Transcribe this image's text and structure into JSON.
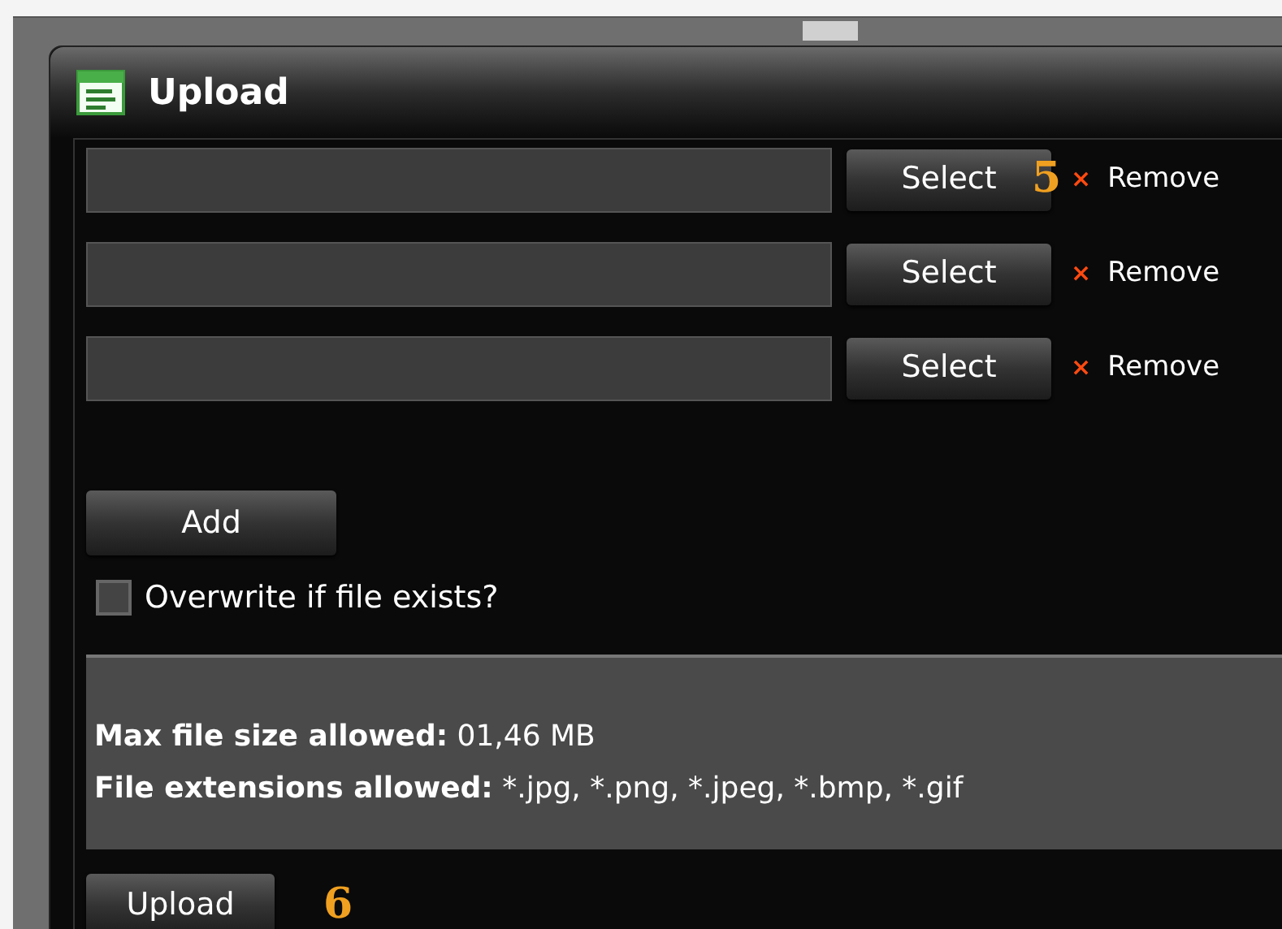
{
  "window": {
    "title": "Upload"
  },
  "file_rows": [
    {
      "select_label": "Select",
      "remove_label": "×",
      "remove_text": "Remove",
      "callout": "5"
    },
    {
      "select_label": "Select",
      "remove_label": "×",
      "remove_text": "Remove"
    },
    {
      "select_label": "Select",
      "remove_label": "×",
      "remove_text": "Remove"
    }
  ],
  "add_button": "Add",
  "overwrite": {
    "label": "Overwrite if file exists?",
    "checked": false
  },
  "info": [
    "**Max file size allowed:** 01,46 MB",
    "**File extensions allowed:** *.jpg, *.png, *.jpeg, *.bmp, *.gif"
  ],
  "upload_button": "Upload",
  "upload_callout": "6"
}
